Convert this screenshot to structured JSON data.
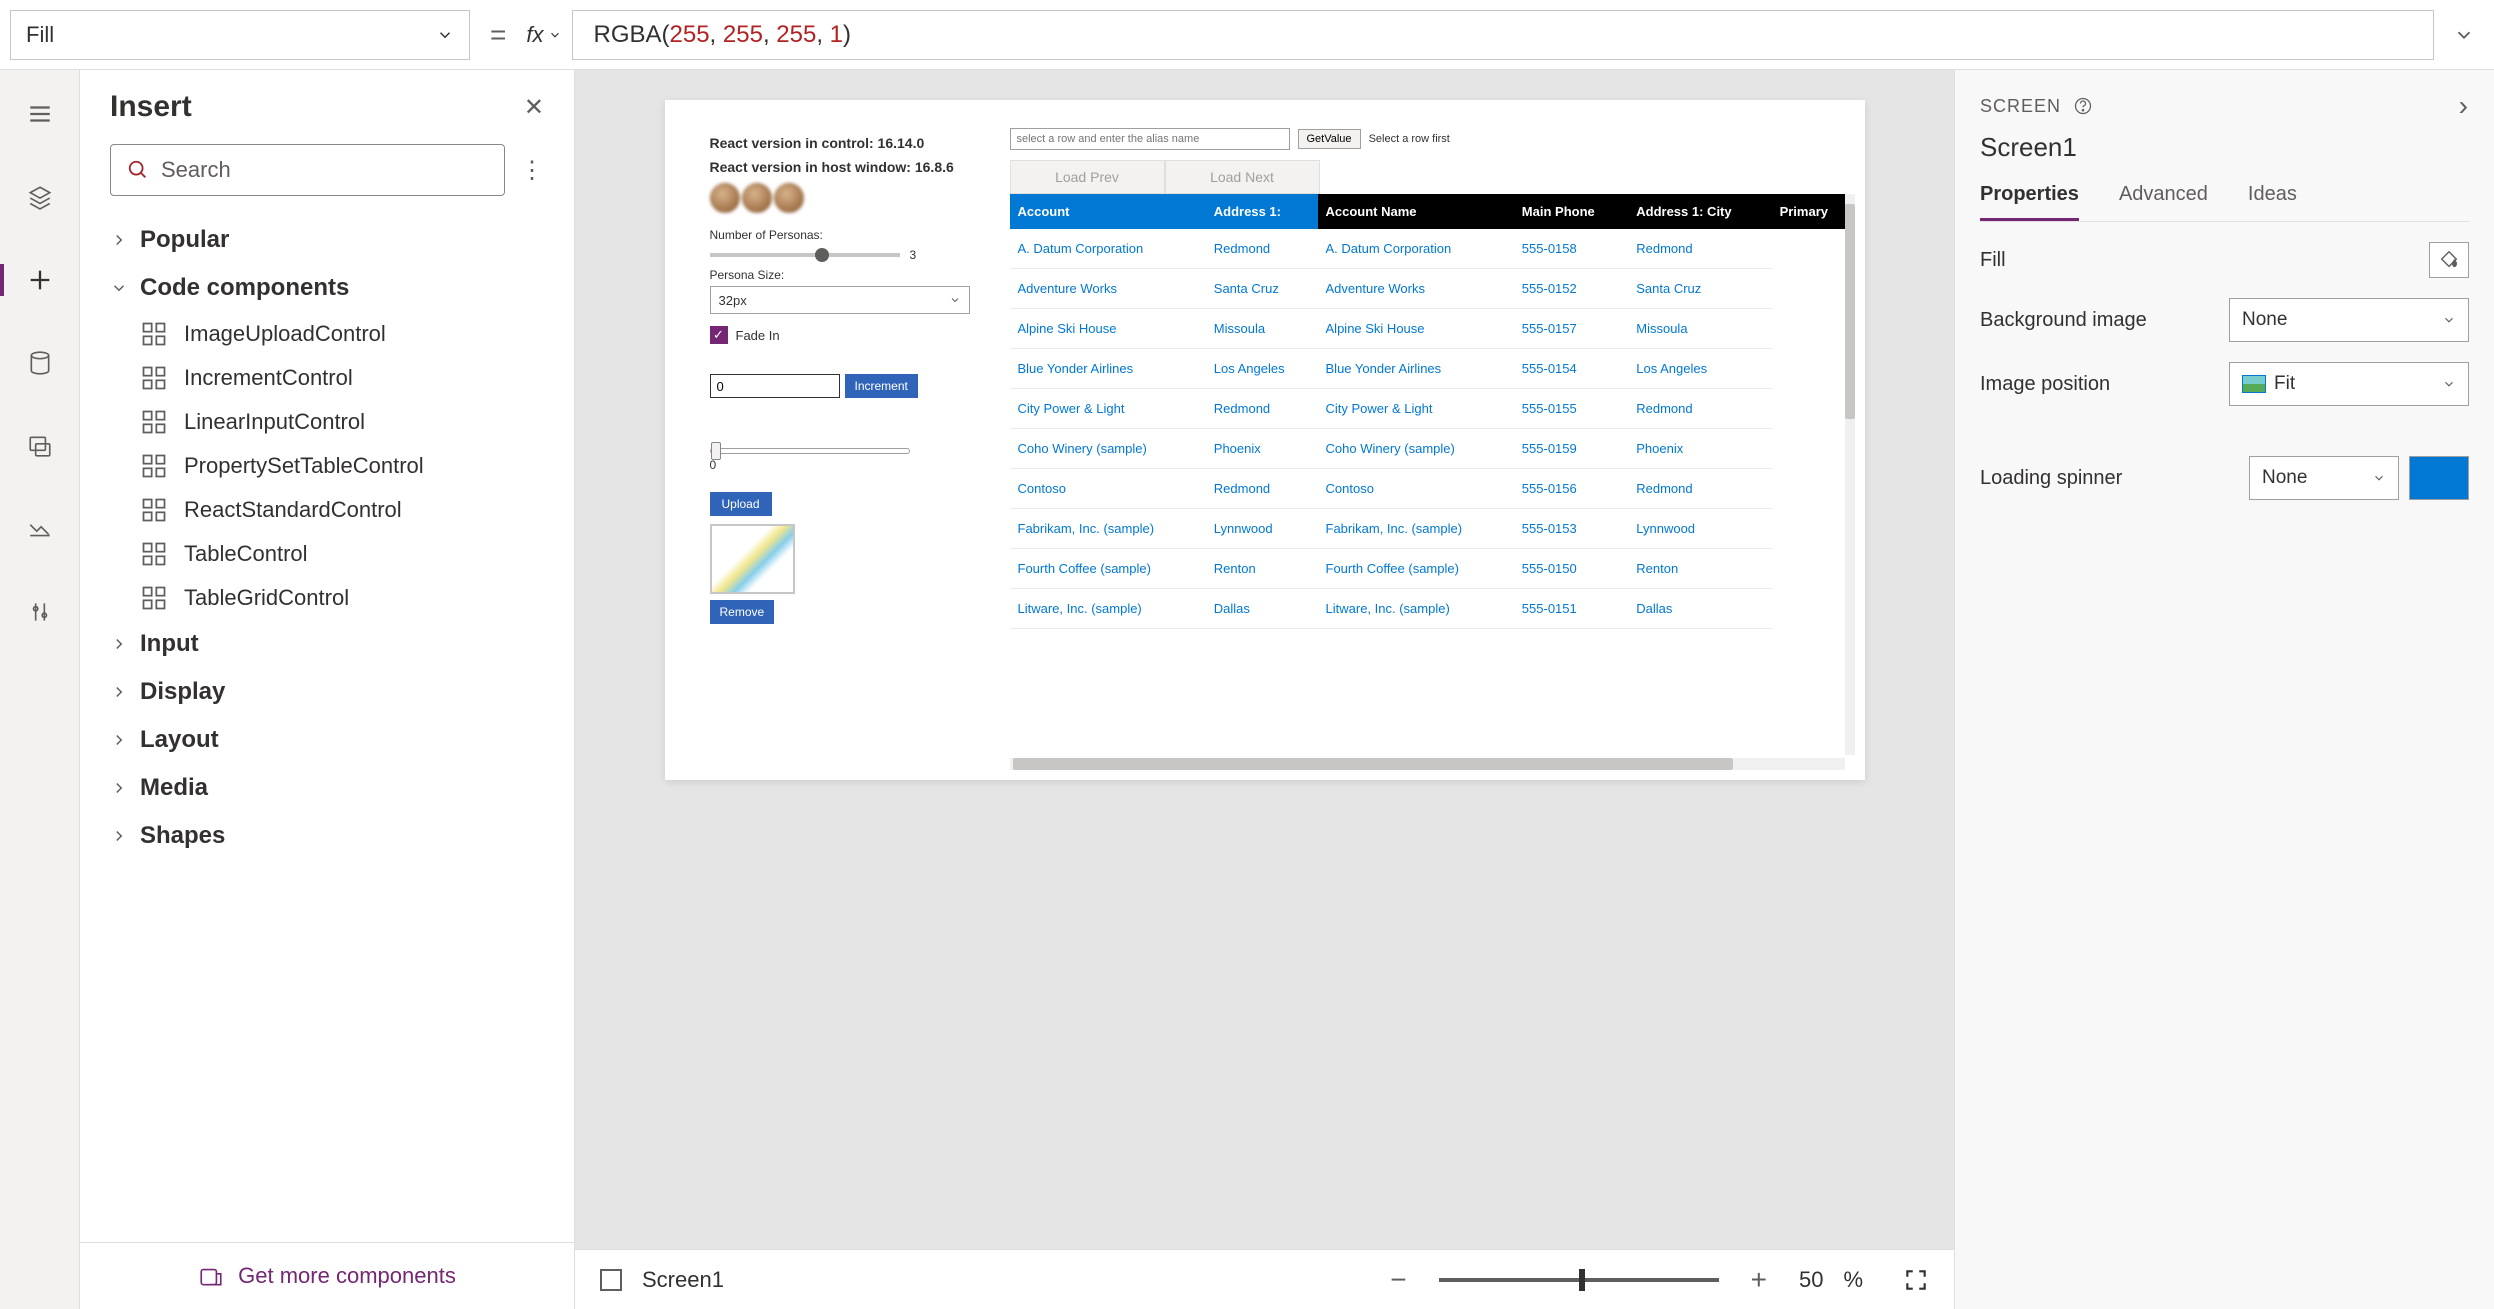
{
  "formula": {
    "property": "Fill",
    "fx": "fx",
    "fn": "RGBA",
    "args": [
      "255",
      "255",
      "255",
      "1"
    ]
  },
  "insert": {
    "title": "Insert",
    "search_placeholder": "Search",
    "groups": {
      "popular": "Popular",
      "code": "Code components",
      "input": "Input",
      "display": "Display",
      "layout": "Layout",
      "media": "Media",
      "shapes": "Shapes"
    },
    "code_items": [
      "ImageUploadControl",
      "IncrementControl",
      "LinearInputControl",
      "PropertySetTableControl",
      "ReactStandardControl",
      "TableControl",
      "TableGridControl"
    ],
    "footer": "Get more components"
  },
  "canvas": {
    "react_control": "React version in control: 16.14.0",
    "react_host": "React version in host window: 16.8.6",
    "num_personas_label": "Number of Personas:",
    "num_personas_val": "3",
    "persona_size_label": "Persona Size:",
    "persona_size_val": "32px",
    "fade": "Fade In",
    "increment_val": "0",
    "increment": "Increment",
    "slider2_val": "0",
    "upload": "Upload",
    "remove": "Remove",
    "alias_placeholder": "select a row and enter the alias name",
    "get_value": "GetValue",
    "hint": "Select a row first",
    "load_prev": "Load Prev",
    "load_next": "Load Next",
    "columns": [
      "Account",
      "Address 1:",
      "Account Name",
      "Main Phone",
      "Address 1: City",
      "Primary"
    ],
    "rows": [
      [
        "A. Datum Corporation",
        "Redmond",
        "A. Datum Corporation",
        "555-0158",
        "Redmond"
      ],
      [
        "Adventure Works",
        "Santa Cruz",
        "Adventure Works",
        "555-0152",
        "Santa Cruz"
      ],
      [
        "Alpine Ski House",
        "Missoula",
        "Alpine Ski House",
        "555-0157",
        "Missoula"
      ],
      [
        "Blue Yonder Airlines",
        "Los Angeles",
        "Blue Yonder Airlines",
        "555-0154",
        "Los Angeles"
      ],
      [
        "City Power & Light",
        "Redmond",
        "City Power & Light",
        "555-0155",
        "Redmond"
      ],
      [
        "Coho Winery (sample)",
        "Phoenix",
        "Coho Winery (sample)",
        "555-0159",
        "Phoenix"
      ],
      [
        "Contoso",
        "Redmond",
        "Contoso",
        "555-0156",
        "Redmond"
      ],
      [
        "Fabrikam, Inc. (sample)",
        "Lynnwood",
        "Fabrikam, Inc. (sample)",
        "555-0153",
        "Lynnwood"
      ],
      [
        "Fourth Coffee (sample)",
        "Renton",
        "Fourth Coffee (sample)",
        "555-0150",
        "Renton"
      ],
      [
        "Litware, Inc. (sample)",
        "Dallas",
        "Litware, Inc. (sample)",
        "555-0151",
        "Dallas"
      ]
    ]
  },
  "status": {
    "screen": "Screen1",
    "zoom": "50",
    "pct": "%"
  },
  "props": {
    "breadcrumb": "SCREEN",
    "name": "Screen1",
    "tabs": {
      "properties": "Properties",
      "advanced": "Advanced",
      "ideas": "Ideas"
    },
    "fill_label": "Fill",
    "bg_image_label": "Background image",
    "bg_image_value": "None",
    "img_pos_label": "Image position",
    "img_pos_value": "Fit",
    "spinner_label": "Loading spinner",
    "spinner_value": "None"
  }
}
